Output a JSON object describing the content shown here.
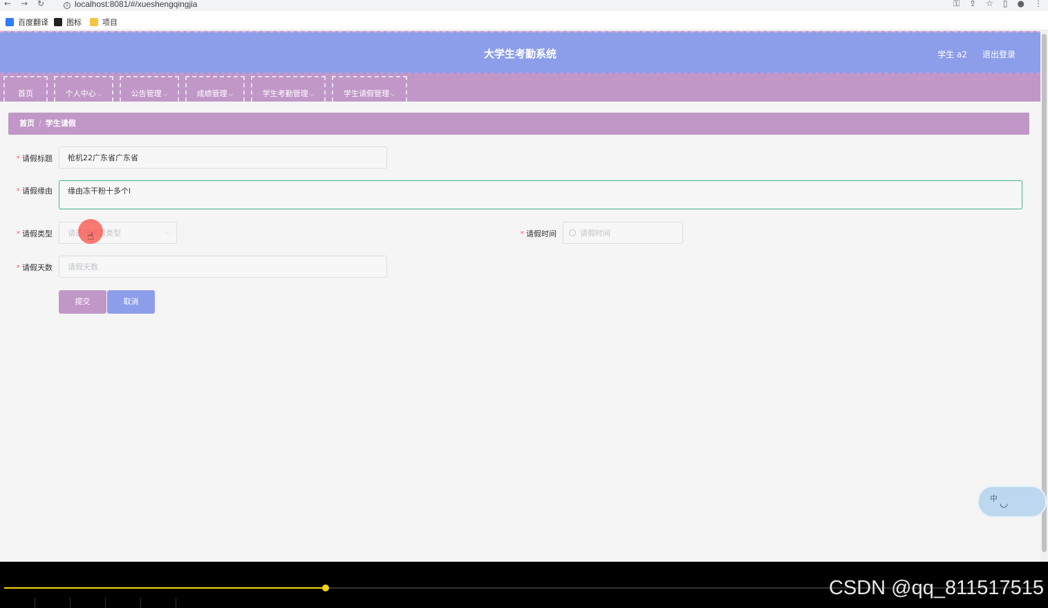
{
  "browser": {
    "url": "localhost:8081/#/xueshengqingjia",
    "bookmarks": [
      {
        "label": "百度翻译",
        "color": "#2f7cf6"
      },
      {
        "label": "图标",
        "color": "#222222"
      },
      {
        "label": "项目",
        "color": "#f5c542"
      }
    ]
  },
  "header": {
    "title": "大学生考勤系统",
    "user": "学生 a2",
    "logout": "退出登录"
  },
  "menu": [
    {
      "label": "首页",
      "has_dropdown": false
    },
    {
      "label": "个人中心",
      "has_dropdown": true
    },
    {
      "label": "公告管理",
      "has_dropdown": true
    },
    {
      "label": "成绩管理",
      "has_dropdown": true
    },
    {
      "label": "学生考勤管理",
      "has_dropdown": true
    },
    {
      "label": "学生请假管理",
      "has_dropdown": true
    }
  ],
  "breadcrumb": {
    "home": "首页",
    "current": "学生请假"
  },
  "form": {
    "title_label": "请假标题",
    "title_value": "枪机22广东省广东省",
    "reason_label": "请假缘由",
    "reason_value": "缘由冻干粉十多个l",
    "type_label": "请假类型",
    "type_placeholder": "请选择请假类型",
    "time_label": "请假时间",
    "time_placeholder": "请假时间",
    "days_label": "请假天数",
    "days_placeholder": "请假天数",
    "submit": "提交",
    "cancel": "取消"
  },
  "ime": {
    "label": "中"
  },
  "player": {
    "progress": 0.31
  },
  "watermark": "CSDN @qq_811517515",
  "colors": {
    "header": "#8c9eea",
    "menu": "#c097c7",
    "required": "#f56c6c",
    "progress": "#f3d60e"
  }
}
